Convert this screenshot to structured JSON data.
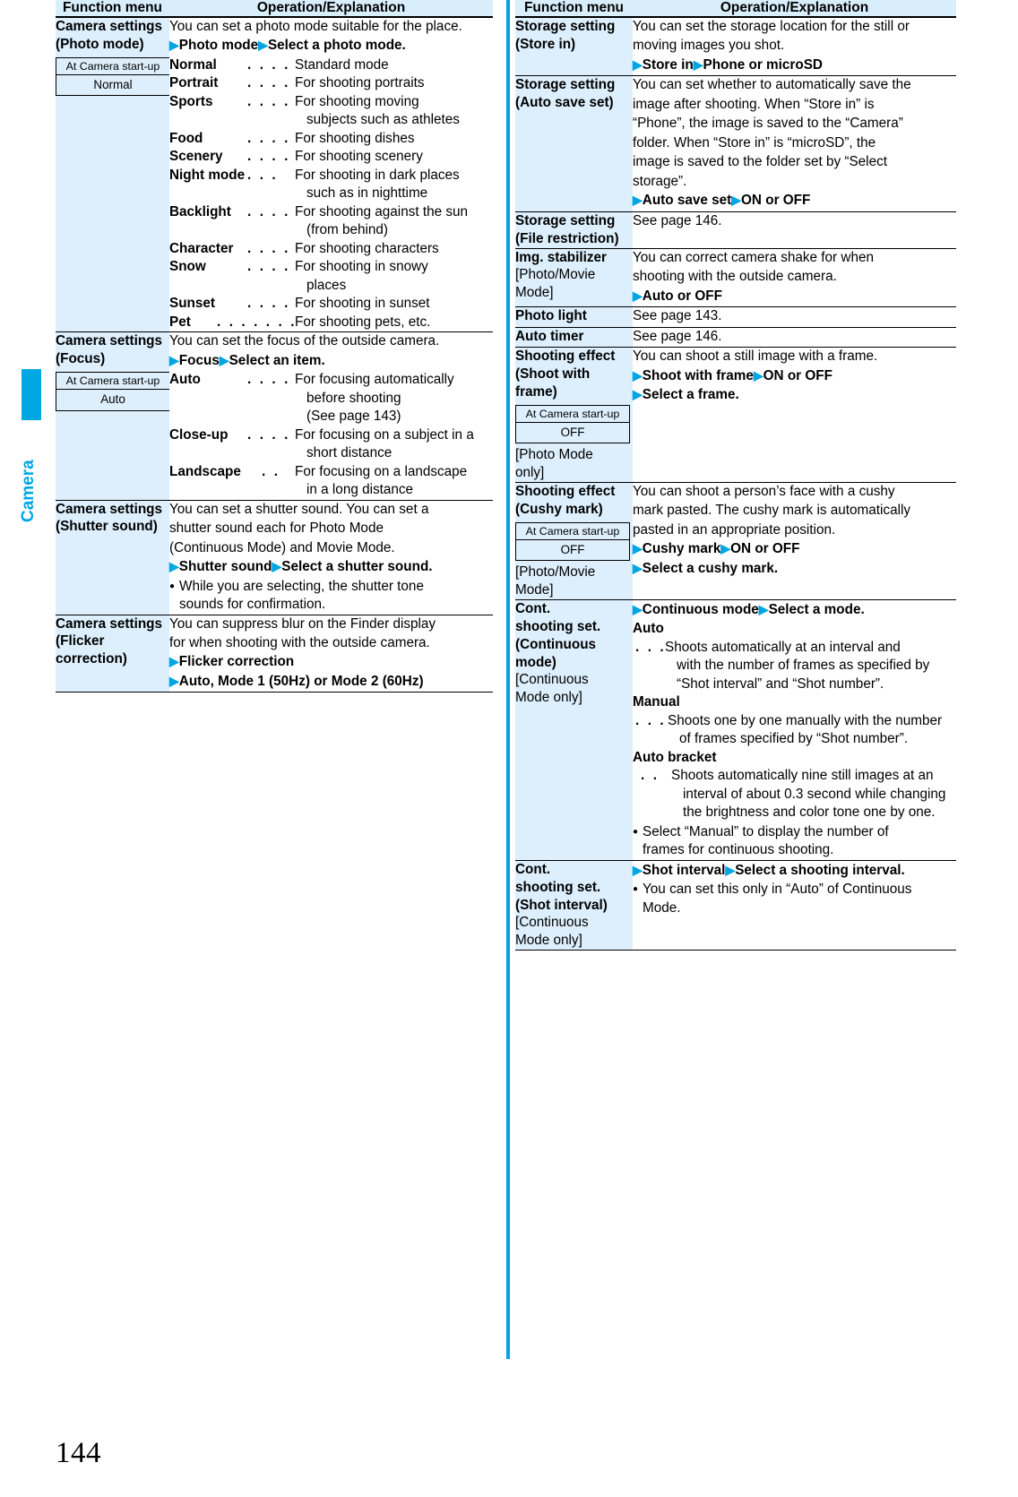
{
  "page": {
    "number": "144",
    "section_tab": "Camera"
  },
  "table_headers": {
    "function_menu": "Function menu",
    "operation": "Operation/Explanation"
  },
  "startup_label": "At Camera start-up",
  "colors": {
    "accent": "#00a6e2",
    "menu_cell_bg": "#ddeffc",
    "header_bg": "#d9eefb"
  },
  "left_column": {
    "rows": [
      {
        "menu_title": "Camera settings",
        "menu_sub": "(Photo mode)",
        "startup_default": "Normal",
        "intro": "You can set a photo mode suitable for the place.",
        "steps": [
          "Photo mode",
          "Select a photo mode."
        ],
        "definitions": [
          {
            "term": "Normal",
            "dots": ". . . . . . .",
            "desc": [
              "Standard mode"
            ]
          },
          {
            "term": "Portrait",
            "dots": ". . . . . .",
            "desc": [
              "For shooting portraits"
            ]
          },
          {
            "term": "Sports",
            "dots": ". . . . . . .",
            "desc": [
              "For shooting moving",
              "subjects such as athletes"
            ]
          },
          {
            "term": "Food",
            "dots": ". . . . . . . .",
            "desc": [
              "For shooting dishes"
            ]
          },
          {
            "term": "Scenery",
            "dots": ". . . . . .",
            "desc": [
              "For shooting scenery"
            ]
          },
          {
            "term": "Night mode",
            "dots": ". . .",
            "desc": [
              "For shooting in dark places",
              "such as in nighttime"
            ]
          },
          {
            "term": "Backlight",
            "dots": ". . . . .",
            "desc": [
              "For shooting against the sun",
              "(from behind)"
            ]
          },
          {
            "term": "Character",
            "dots": ". . . .",
            "desc": [
              "For shooting characters"
            ]
          },
          {
            "term": "Snow",
            "dots": ". . . . . . . .",
            "desc": [
              "For shooting in snowy",
              "places"
            ]
          },
          {
            "term": "Sunset",
            "dots": ". . . . . . .",
            "desc": [
              "For shooting in sunset"
            ]
          },
          {
            "term": "Pet",
            "dots": ". . . . . . . . . .",
            "desc": [
              "For shooting pets, etc."
            ]
          }
        ]
      },
      {
        "menu_title": "Camera settings",
        "menu_sub": "(Focus)",
        "startup_default": "Auto",
        "intro": "You can set the focus of the outside camera.",
        "steps": [
          "Focus",
          "Select an item."
        ],
        "definitions": [
          {
            "term": "Auto",
            "dots": ". . . . . . . .",
            "desc": [
              "For focusing automatically",
              "before shooting",
              "(See page 143)"
            ]
          },
          {
            "term": "Close-up",
            "dots": ". . . .",
            "desc": [
              "For focusing on a subject in a",
              "short distance"
            ]
          },
          {
            "term": "Landscape",
            "dots": ". .",
            "desc": [
              "For focusing on a landscape",
              "in a long distance"
            ]
          }
        ]
      },
      {
        "menu_title": "Camera settings",
        "menu_sub": "(Shutter sound)",
        "intro_lines": [
          "You can set a shutter sound. You can set a",
          "shutter sound each for Photo Mode",
          "(Continuous Mode) and Movie Mode."
        ],
        "steps": [
          "Shutter sound",
          "Select a shutter sound."
        ],
        "notes": [
          {
            "lines": [
              "While you are selecting, the shutter tone",
              "sounds for confirmation."
            ]
          }
        ]
      },
      {
        "menu_title": "Camera settings",
        "menu_sub": "(Flicker",
        "menu_sub2": "correction)",
        "intro_lines": [
          "You can suppress blur on the Finder display",
          "for when shooting with the outside camera."
        ],
        "step_lines": [
          "Flicker correction",
          "Auto, Mode 1 (50Hz) or Mode 2 (60Hz)"
        ]
      }
    ]
  },
  "right_column": {
    "rows": [
      {
        "menu_title": "Storage setting",
        "menu_sub": "(Store in)",
        "intro_lines": [
          "You can set the storage location for the still or",
          "moving images you shot."
        ],
        "steps": [
          "Store in",
          "Phone or microSD"
        ]
      },
      {
        "menu_title": "Storage setting",
        "menu_sub": "(Auto save set)",
        "intro_lines": [
          "You can set whether to automatically save the",
          "image after shooting. When “Store in” is",
          "“Phone”, the image is saved to the “Camera”",
          "folder. When “Store in” is “microSD”, the",
          "image is saved to the folder set by “Select",
          "storage”."
        ],
        "steps": [
          "Auto save set",
          "ON or OFF"
        ]
      },
      {
        "menu_title": "Storage setting",
        "menu_sub": "(File restriction)",
        "intro_lines": [
          "See page 146."
        ]
      },
      {
        "menu_title": "Img. stabilizer",
        "menu_bracket": "[Photo/Movie",
        "menu_bracket2": "Mode]",
        "intro_lines": [
          "You can correct camera shake for when",
          "shooting with the outside camera."
        ],
        "step_lines": [
          "Auto or OFF"
        ]
      },
      {
        "menu_title": "Photo light",
        "intro_lines": [
          "See page 143."
        ]
      },
      {
        "menu_title": "Auto timer",
        "intro_lines": [
          "See page 146."
        ]
      },
      {
        "menu_title": "Shooting effect",
        "menu_sub": "(Shoot with",
        "menu_sub2": "frame)",
        "startup_default": "OFF",
        "menu_bracket": "[Photo Mode",
        "menu_bracket2": "only]",
        "intro_lines": [
          "You can shoot a still image with a frame."
        ],
        "steps": [
          "Shoot with frame",
          "ON or OFF"
        ],
        "step_lines": [
          "Select a frame."
        ]
      },
      {
        "menu_title": "Shooting effect",
        "menu_sub": "(Cushy mark)",
        "startup_default": "OFF",
        "menu_bracket": "[Photo/Movie",
        "menu_bracket2": "Mode]",
        "intro_lines": [
          "You can shoot a person’s face with a cushy",
          "mark pasted. The cushy mark is automatically",
          "pasted in an appropriate position."
        ],
        "steps": [
          "Cushy mark",
          "ON or OFF"
        ],
        "step_lines": [
          "Select a cushy mark."
        ]
      },
      {
        "menu_title": "Cont.",
        "menu_title2": "shooting set.",
        "menu_sub": "(Continuous",
        "menu_sub2": "mode)",
        "menu_bracket": "[Continuous",
        "menu_bracket2": "Mode only]",
        "steps": [
          "Continuous mode",
          "Select a mode."
        ],
        "definitions": [
          {
            "term": "Auto",
            "dots": ". . .",
            "desc": [
              "Shoots automatically at an interval and",
              "with the number of frames as specified by",
              "“Shot interval” and “Shot number”."
            ]
          },
          {
            "term": "Manual",
            "dots": ". . .",
            "desc": [
              "Shoots one by one manually with the number",
              "of frames specified by “Shot number”."
            ]
          },
          {
            "term": "Auto bracket",
            "dots": ". .",
            "desc": [
              "Shoots automatically nine still images at an",
              "interval of about 0.3 second while changing",
              "the brightness and color tone one by one."
            ]
          }
        ],
        "notes": [
          {
            "lines": [
              "Select “Manual” to display the number of",
              "frames for continuous shooting."
            ]
          }
        ]
      },
      {
        "menu_title": "Cont.",
        "menu_title2": "shooting set.",
        "menu_sub": "(Shot interval)",
        "menu_bracket": "[Continuous",
        "menu_bracket2": "Mode only]",
        "steps": [
          "Shot interval",
          "Select a shooting interval."
        ],
        "notes": [
          {
            "lines": [
              "You can set this only in “Auto” of Continuous",
              "Mode."
            ]
          }
        ]
      }
    ]
  }
}
